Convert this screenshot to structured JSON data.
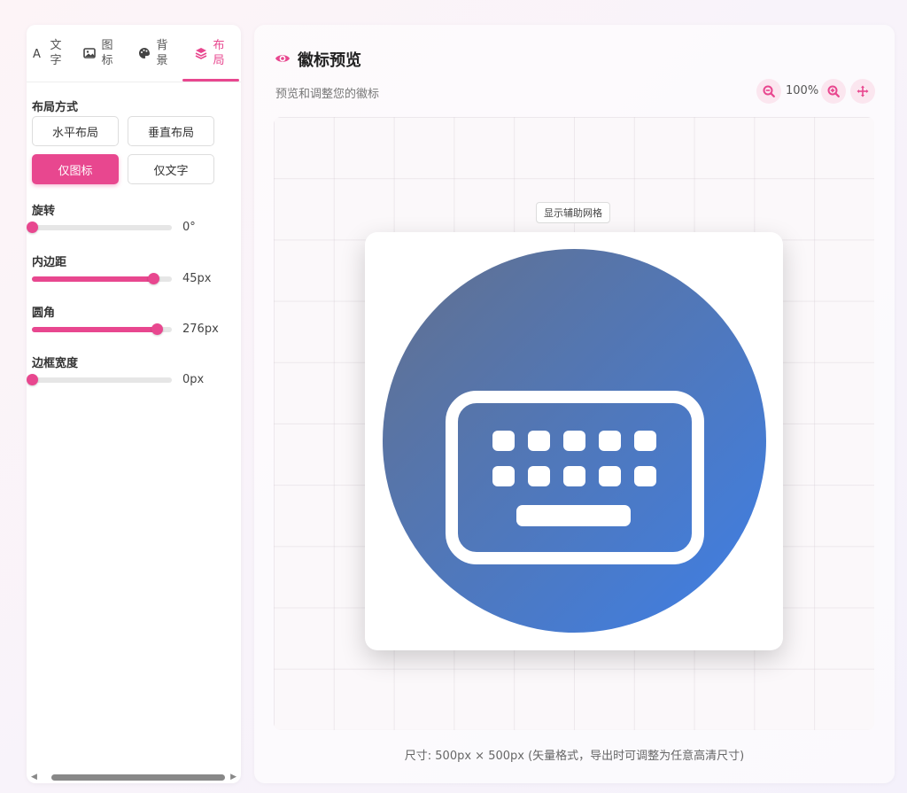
{
  "tabs": [
    {
      "label": "文字",
      "icon": "text-icon"
    },
    {
      "label": "图标",
      "icon": "image-icon"
    },
    {
      "label": "背景",
      "icon": "palette-icon"
    },
    {
      "label": "布局",
      "icon": "layers-icon",
      "active": true
    }
  ],
  "layout": {
    "section_label": "布局方式",
    "buttons": [
      {
        "label": "水平布局",
        "active": false
      },
      {
        "label": "垂直布局",
        "active": false
      },
      {
        "label": "仅图标",
        "active": true
      },
      {
        "label": "仅文字",
        "active": false
      }
    ]
  },
  "sliders": [
    {
      "label": "旋转",
      "value": "0°",
      "fraction": 0.0
    },
    {
      "label": "内边距",
      "value": "45px",
      "fraction": 0.87
    },
    {
      "label": "圆角",
      "value": "276px",
      "fraction": 0.89
    },
    {
      "label": "边框宽度",
      "value": "0px",
      "fraction": 0.0
    }
  ],
  "preview": {
    "title": "徽标预览",
    "subtitle": "预览和调整您的徽标",
    "zoom": "100%",
    "grid_toggle": "显示辅助网格",
    "footer": "尺寸: 500px × 500px (矢量格式，导出时可调整为任意高清尺寸)",
    "icon": "keyboard-icon"
  },
  "colors": {
    "accent": "#e8478f",
    "badge_gradient_start": "#62708e",
    "badge_gradient_end": "#3e7fe6"
  }
}
